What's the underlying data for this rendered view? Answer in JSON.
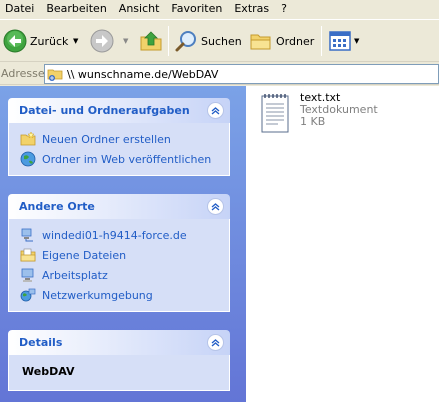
{
  "menu": [
    "Datei",
    "Bearbeiten",
    "Ansicht",
    "Favoriten",
    "Extras",
    "?"
  ],
  "toolbar": {
    "back_label": "Zurück",
    "search_label": "Suchen",
    "folders_label": "Ordner"
  },
  "address": {
    "label": "Adresse",
    "value": "\\\\ wunschname.de/WebDAV"
  },
  "tasks": {
    "title": "Datei- und Ordneraufgaben",
    "items": [
      "Neuen Ordner erstellen",
      "Ordner im Web veröffentlichen"
    ]
  },
  "places": {
    "title": "Andere Orte",
    "items": [
      "windedi01-h9414-force.de",
      "Eigene Dateien",
      "Arbeitsplatz",
      "Netzwerkumgebung"
    ]
  },
  "details": {
    "title": "Details",
    "value": "WebDAV"
  },
  "file": {
    "name": "text.txt",
    "type": "Textdokument",
    "size": "1 KB"
  },
  "colors": {
    "pane_top": "#7ba2e7",
    "pane_bottom": "#6375d6",
    "link": "#215dc6",
    "chrome": "#ECE9D8"
  }
}
